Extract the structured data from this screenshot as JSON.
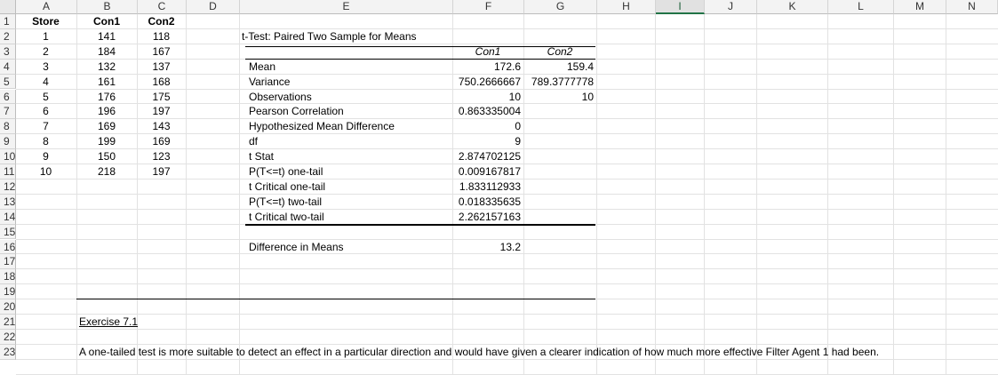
{
  "columns": [
    "A",
    "B",
    "C",
    "D",
    "E",
    "F",
    "G",
    "H",
    "I",
    "J",
    "K",
    "L",
    "M",
    "N"
  ],
  "rows": [
    "1",
    "2",
    "3",
    "4",
    "5",
    "6",
    "7",
    "8",
    "9",
    "10",
    "11",
    "12",
    "13",
    "14",
    "15",
    "16",
    "17",
    "18",
    "19",
    "20",
    "21",
    "22",
    "23"
  ],
  "data_table": {
    "headers": [
      "Store",
      "Con1",
      "Con2"
    ],
    "rows": [
      [
        "1",
        "141",
        "118"
      ],
      [
        "2",
        "184",
        "167"
      ],
      [
        "3",
        "132",
        "137"
      ],
      [
        "4",
        "161",
        "168"
      ],
      [
        "5",
        "176",
        "175"
      ],
      [
        "6",
        "196",
        "197"
      ],
      [
        "7",
        "169",
        "143"
      ],
      [
        "8",
        "199",
        "169"
      ],
      [
        "9",
        "150",
        "123"
      ],
      [
        "10",
        "218",
        "197"
      ]
    ]
  },
  "ttest": {
    "title": "t-Test: Paired Two Sample for Means",
    "col1": "Con1",
    "col2": "Con2",
    "rows": [
      [
        "Mean",
        "172.6",
        "159.4"
      ],
      [
        "Variance",
        "750.2666667",
        "789.3777778"
      ],
      [
        "Observations",
        "10",
        "10"
      ],
      [
        "Pearson Correlation",
        "0.863335004",
        ""
      ],
      [
        "Hypothesized Mean Difference",
        "0",
        ""
      ],
      [
        "df",
        "9",
        ""
      ],
      [
        "t Stat",
        "2.874702125",
        ""
      ],
      [
        "P(T<=t) one-tail",
        "0.009167817",
        ""
      ],
      [
        "t Critical one-tail",
        "1.833112933",
        ""
      ],
      [
        "P(T<=t) two-tail",
        "0.018335635",
        ""
      ],
      [
        "t Critical two-tail",
        "2.262157163",
        ""
      ]
    ]
  },
  "difference": {
    "label": "Difference in Means",
    "value": "13.2"
  },
  "exercise": {
    "title": "Exercise 7.1",
    "text": "A one-tailed test is more suitable to detect an effect in a particular direction and would have given a clearer indication of how much more effective Filter Agent 1 had been."
  },
  "selected_column": "I"
}
